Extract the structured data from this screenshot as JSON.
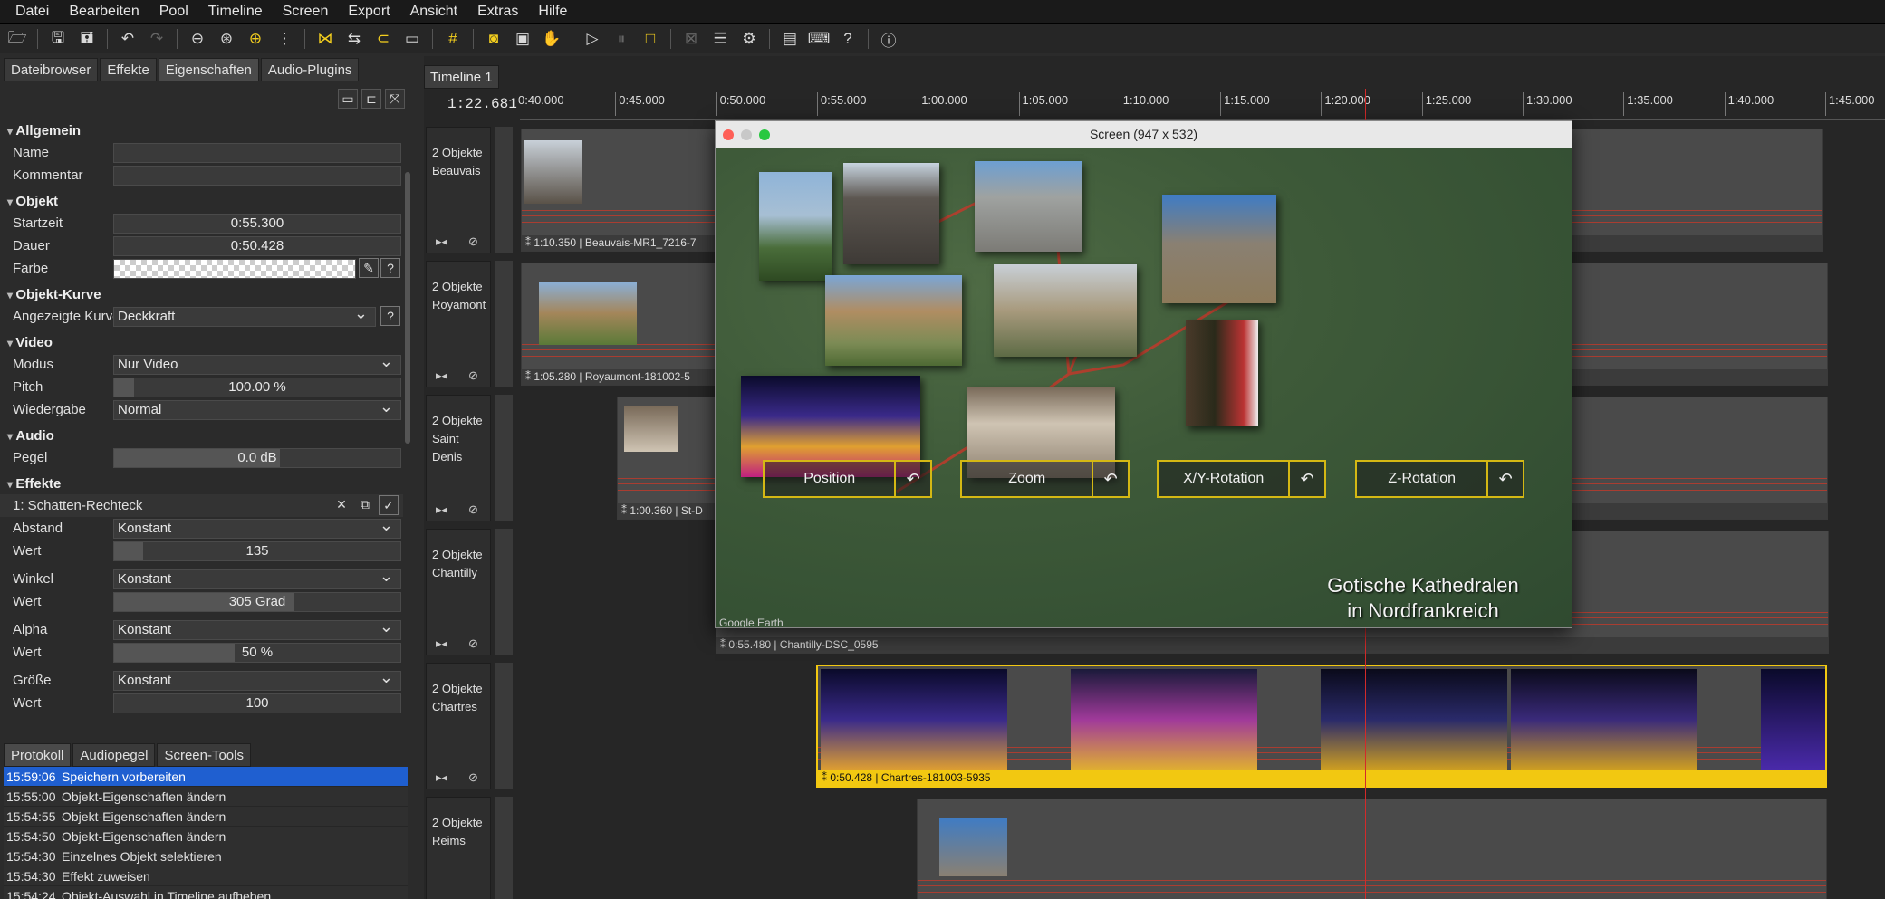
{
  "menu": [
    "Datei",
    "Bearbeiten",
    "Pool",
    "Timeline",
    "Screen",
    "Export",
    "Ansicht",
    "Extras",
    "Hilfe"
  ],
  "left_tabs": [
    "Dateibrowser",
    "Effekte",
    "Eigenschaften",
    "Audio-Plugins"
  ],
  "sections": {
    "allgemein": "Allgemein",
    "objekt": "Objekt",
    "kurve": "Objekt-Kurve",
    "video": "Video",
    "audio": "Audio",
    "effekte": "Effekte"
  },
  "props": {
    "name_label": "Name",
    "kommentar_label": "Kommentar",
    "startzeit_label": "Startzeit",
    "startzeit": "0:55.300",
    "dauer_label": "Dauer",
    "dauer": "0:50.428",
    "farbe_label": "Farbe",
    "kurve_label": "Angezeigte Kurve",
    "kurve": "Deckkraft",
    "modus_label": "Modus",
    "modus": "Nur Video",
    "pitch_label": "Pitch",
    "pitch": "100.00 %",
    "wiedergabe_label": "Wiedergabe",
    "wiedergabe": "Normal",
    "pegel_label": "Pegel",
    "pegel": "0.0 dB",
    "effect_name": "1: Schatten-Rechteck",
    "abstand_label": "Abstand",
    "abstand": "Konstant",
    "wert_label": "Wert",
    "abstand_wert": "135",
    "winkel_label": "Winkel",
    "winkel": "Konstant",
    "winkel_wert": "305 Grad",
    "alpha_label": "Alpha",
    "alpha": "Konstant",
    "alpha_wert": "50 %",
    "groesse_label": "Größe",
    "groesse": "Konstant",
    "groesse_wert": "100",
    "help": "?"
  },
  "fills": {
    "pitch": 0.07,
    "pegel": 0.58,
    "abstand_wert": 0.1,
    "winkel_wert": 0.63,
    "alpha_wert": 0.42
  },
  "bottom_tabs": [
    "Protokoll",
    "Audiopegel",
    "Screen-Tools"
  ],
  "log": [
    {
      "t": "15:59:06",
      "m": "Speichern vorbereiten",
      "sel": true
    },
    {
      "t": "15:55:00",
      "m": "Objekt-Eigenschaften ändern"
    },
    {
      "t": "15:54:55",
      "m": "Objekt-Eigenschaften ändern"
    },
    {
      "t": "15:54:50",
      "m": "Objekt-Eigenschaften ändern"
    },
    {
      "t": "15:54:30",
      "m": "Einzelnes Objekt selektieren"
    },
    {
      "t": "15:54:30",
      "m": "Effekt zuweisen"
    },
    {
      "t": "15:54:24",
      "m": "Objekt-Auswahl in Timeline aufheben"
    }
  ],
  "timeline": {
    "tab": "Timeline 1",
    "timecode": "1:22.681",
    "ticks": [
      "0:40.000",
      "0:45.000",
      "0:50.000",
      "0:55.000",
      "1:00.000",
      "1:05.000",
      "1:10.000",
      "1:15.000",
      "1:20.000",
      "1:25.000",
      "1:30.000",
      "1:35.000",
      "1:40.000",
      "1:45.000"
    ],
    "tracks": [
      {
        "count": "2 Objekte",
        "name": "Beauvais",
        "clip": "1:10.350 | Beauvais-MR1_7216-7"
      },
      {
        "count": "2 Objekte",
        "name": "Royamont",
        "clip": "1:05.280 | Royaumont-181002-5"
      },
      {
        "count": "2 Objekte",
        "name": "Saint Denis",
        "clip": "1:00.360 | St-D"
      },
      {
        "count": "2 Objekte",
        "name": "Chantilly",
        "clip": "0:55.480 | Chantilly-DSC_0595"
      },
      {
        "count": "2 Objekte",
        "name": "Chartres",
        "clip": "0:50.428 | Chartres-181003-5935"
      },
      {
        "count": "2 Objekte",
        "name": "Reims",
        "clip": ""
      }
    ]
  },
  "screen": {
    "title": "Screen (947 x 532)",
    "controls": [
      "Position",
      "Zoom",
      "X/Y-Rotation",
      "Z-Rotation"
    ],
    "overlay_line1": "Gotische Kathedralen",
    "overlay_line2": "in Nordfrankreich",
    "google": "Google Earth"
  }
}
